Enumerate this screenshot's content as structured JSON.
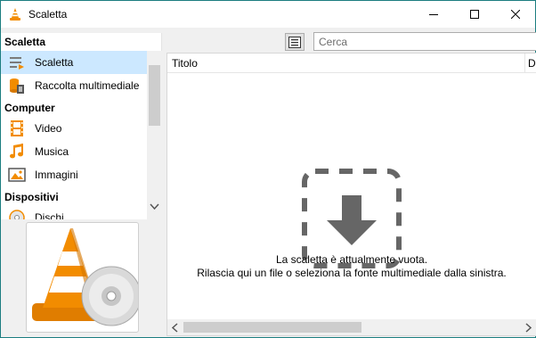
{
  "window": {
    "title": "Scaletta"
  },
  "sidebar": {
    "sections": [
      {
        "heading": "Scaletta",
        "items": [
          {
            "label": "Scaletta",
            "icon": "playlist-icon",
            "selected": true
          },
          {
            "label": "Raccolta multimediale",
            "icon": "media-library-icon",
            "selected": false
          }
        ]
      },
      {
        "heading": "Computer",
        "items": [
          {
            "label": "Video",
            "icon": "film-icon",
            "selected": false
          },
          {
            "label": "Musica",
            "icon": "music-note-icon",
            "selected": false
          },
          {
            "label": "Immagini",
            "icon": "image-icon",
            "selected": false
          }
        ]
      },
      {
        "heading": "Dispositivi",
        "items": [
          {
            "label": "Dischi",
            "icon": "disc-icon",
            "selected": false
          }
        ]
      }
    ]
  },
  "search": {
    "placeholder": "Cerca",
    "value": ""
  },
  "playlist": {
    "columns": [
      "Titolo",
      "D"
    ],
    "empty_line1": "La scaletta è attualmente vuota.",
    "empty_line2": "Rilascia qui un file o seleziona la fonte multimediale dalla sinistra."
  },
  "colors": {
    "accent": "#1b7d80",
    "selection": "#cce8ff",
    "vlc_orange": "#f28c00"
  }
}
